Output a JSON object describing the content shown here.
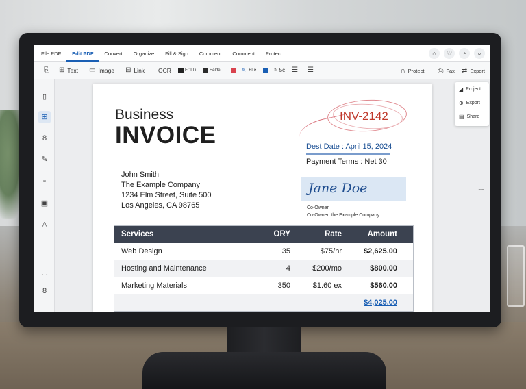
{
  "menu": {
    "items": [
      "File PDF",
      "Edit PDF",
      "Convert",
      "Organize",
      "Fill & Sign",
      "Comment",
      "Comment",
      "Protect"
    ],
    "active_index": 1,
    "right_icons": [
      "home-icon",
      "heart-icon",
      "gear-icon",
      "search-icon"
    ]
  },
  "toolbar": {
    "text_label": "Text",
    "image_label": "Image",
    "link_label": "Link",
    "ocr_label": "OCR",
    "bold_label": "FOLD",
    "font_label": "Helde...",
    "color_label": "Blu•",
    "size_label": "5c",
    "protect_label": "Protect",
    "fax_label": "Fax",
    "export_label": "Export"
  },
  "sidebar": {
    "icons": [
      "pages-icon",
      "edit-icon",
      "bookmark-icon",
      "pen-icon",
      "file-icon",
      "lock-icon",
      "user-icon",
      "link-icon",
      "settings-icon"
    ],
    "active_index": 1
  },
  "document": {
    "title_line1": "Business",
    "title_line2": "INVOICE",
    "invoice_number": "INV-2142",
    "due_date": "Dest Date : April 15, 2024",
    "payment_terms": "Payment Terms : Net 30",
    "billing": {
      "name": "John Smith",
      "company": "The Example Company",
      "street": "1234 Elm Street, Suite 500",
      "city": "Los Angeles, CA 98765"
    },
    "signature": {
      "name": "Jane Doe",
      "role": "Co-Owner",
      "company": "Co-Owner, the Example Company"
    },
    "table": {
      "headers": [
        "Services",
        "ORY",
        "Rate",
        "Amount"
      ],
      "rows": [
        [
          "Web Design",
          "35",
          "$75/hr",
          "$2,625.00"
        ],
        [
          "Hosting and Maintenance",
          "4",
          "$200/mo",
          "$800.00"
        ],
        [
          "Marketing Materials",
          "350",
          "$1.60 ex",
          "$560.00"
        ]
      ],
      "total": "$4,025.00"
    }
  },
  "right_panel": {
    "items": [
      "Project",
      "Export",
      "Share"
    ]
  },
  "colors": {
    "accent": "#1a5fb4",
    "table_header": "#3b4250",
    "annotation_red": "#c0392b"
  }
}
